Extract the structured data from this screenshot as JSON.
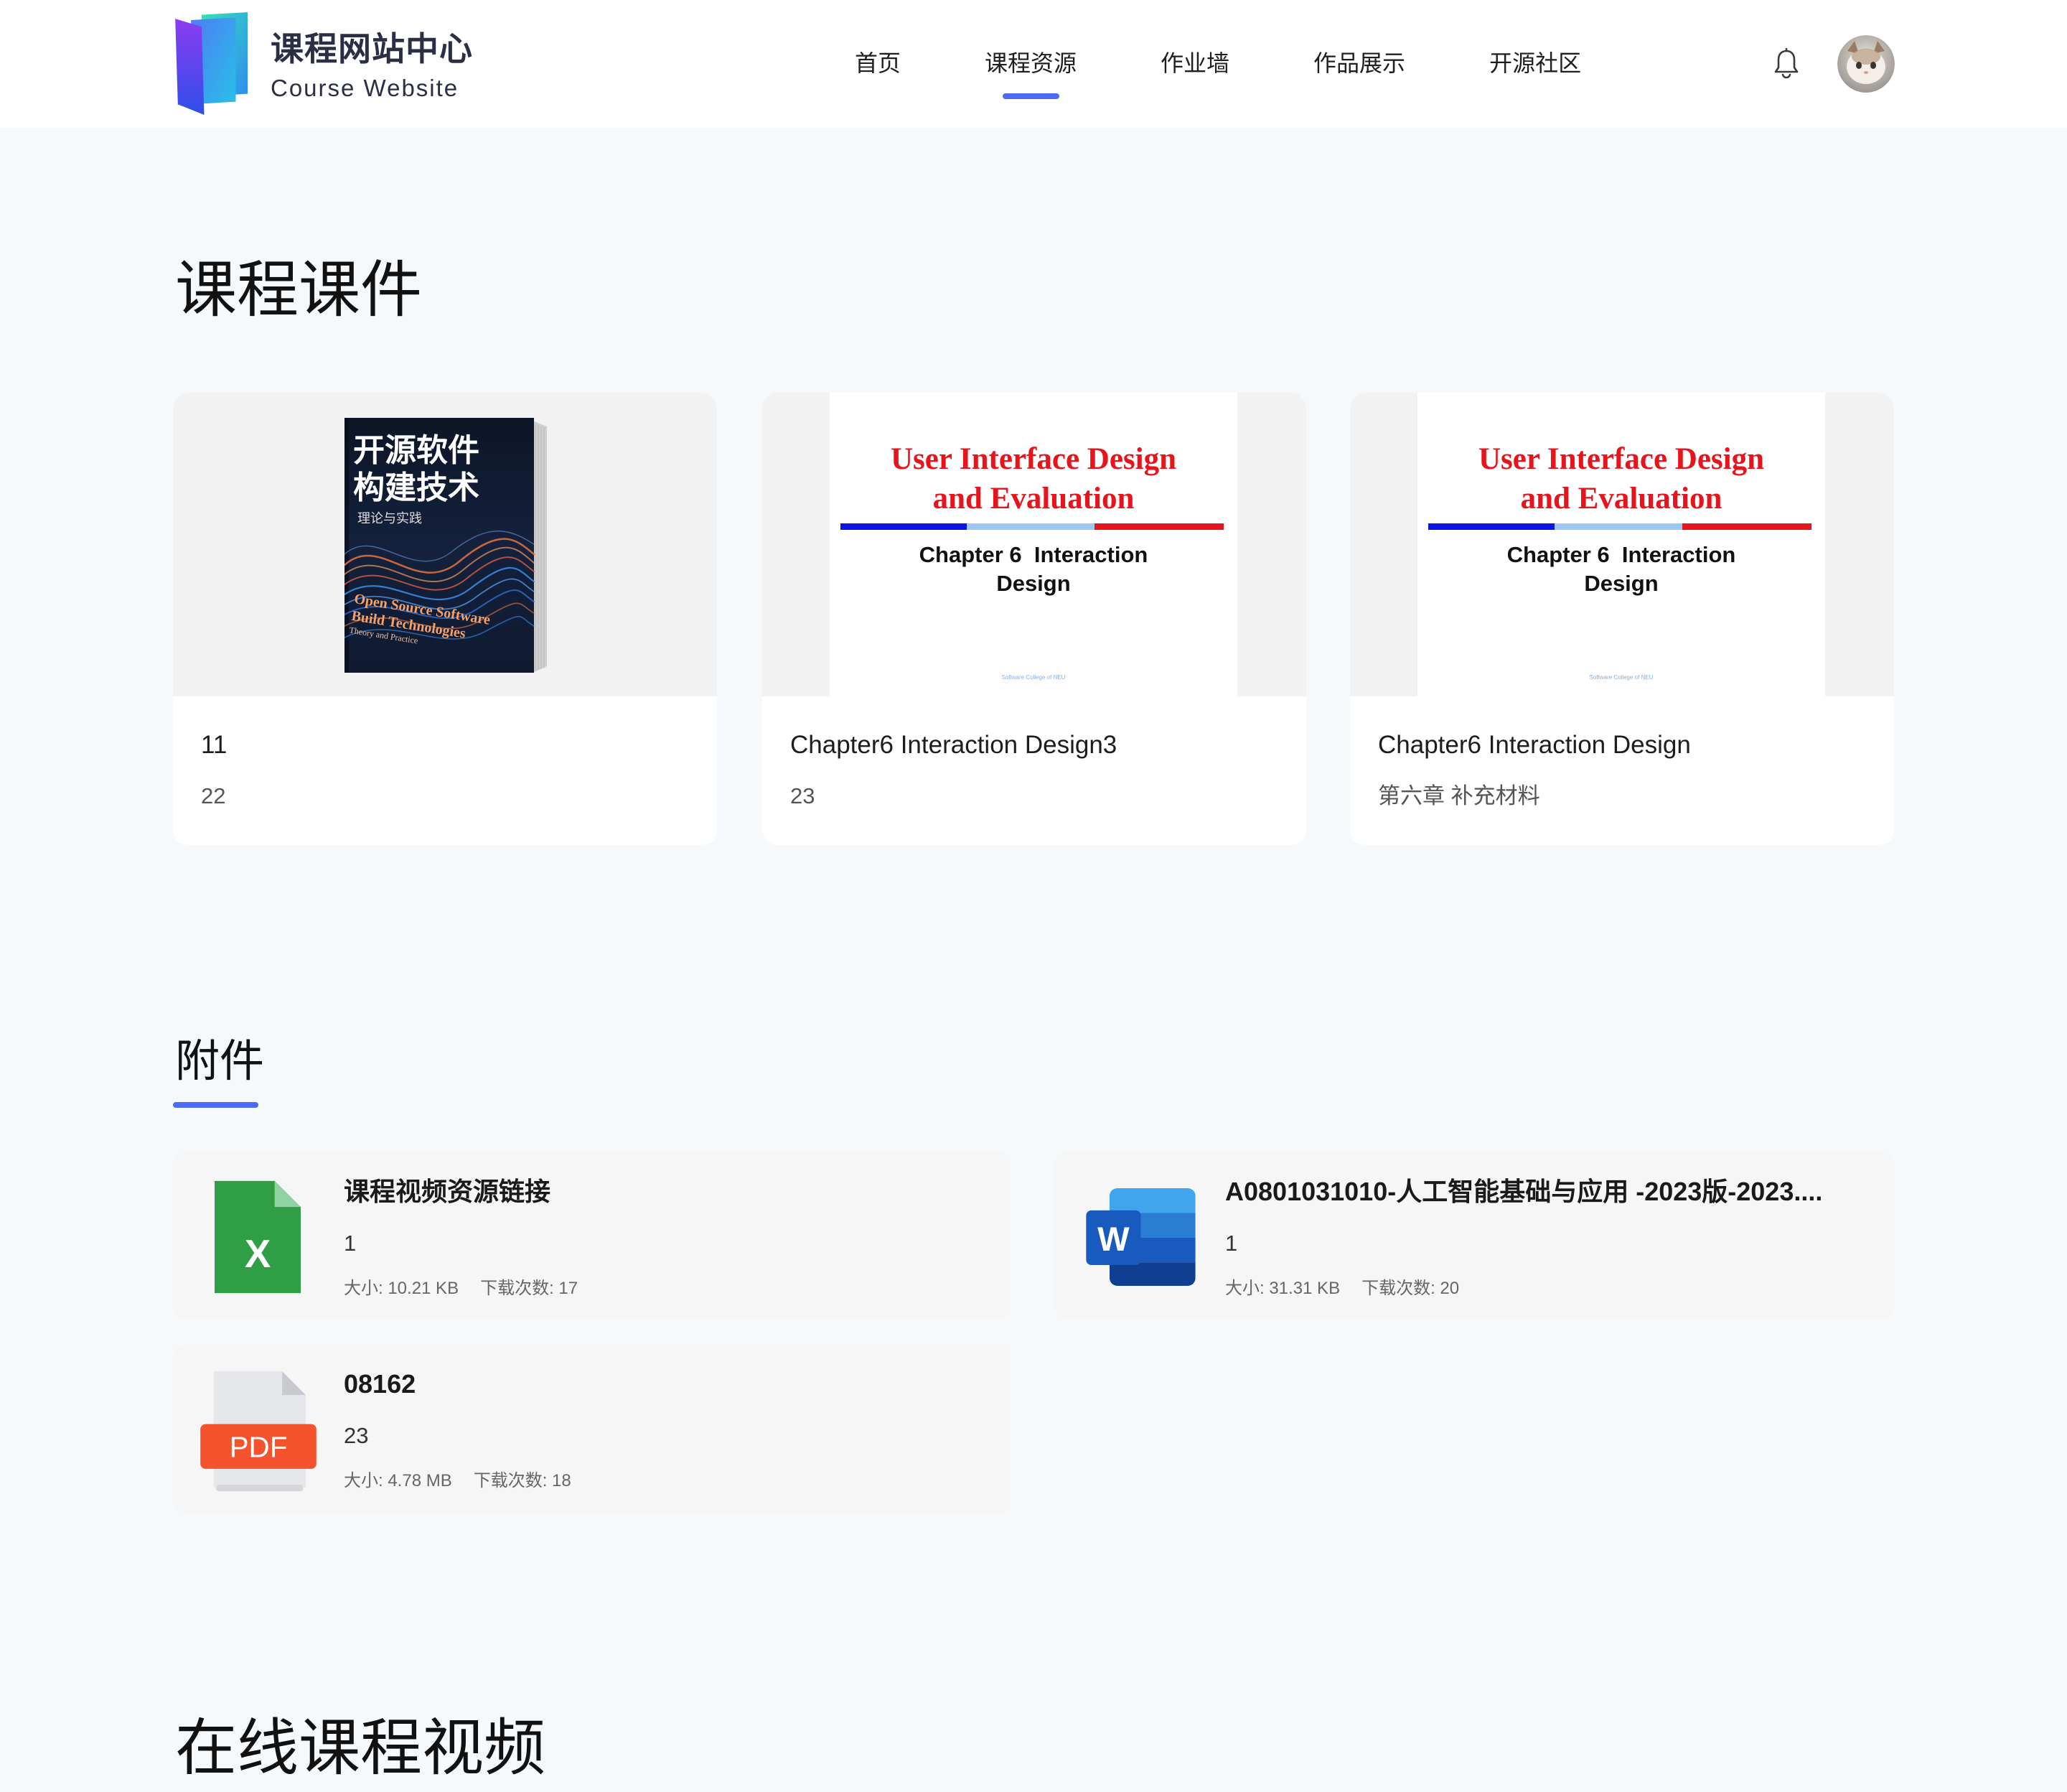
{
  "colors": {
    "accent": "#4a6cf7",
    "page_background": "#f6f9fb",
    "text_primary": "#1a1a1a",
    "text_secondary": "#555555",
    "slide_red": "#e8141b",
    "slide_blue": "#0a14e6",
    "slide_light_blue": "#9cc9f3",
    "excel_green": "#2f9e44",
    "word_blue": "#185abd",
    "pdf_red": "#f5532d"
  },
  "header": {
    "logo": {
      "icon": "book-logo-icon",
      "title": "课程网站中心",
      "subtitle": "Course Website"
    },
    "nav": [
      {
        "label": "首页",
        "active": false
      },
      {
        "label": "课程资源",
        "active": true
      },
      {
        "label": "作业墙",
        "active": false
      },
      {
        "label": "作品展示",
        "active": false
      },
      {
        "label": "开源社区",
        "active": false
      }
    ],
    "notification_icon": "bell-icon",
    "avatar_icon": "cat-avatar"
  },
  "courseware": {
    "title": "课程课件",
    "cards": [
      {
        "title": "11",
        "subtitle": "22",
        "cover": {
          "type": "book",
          "title_line1": "开源软件",
          "title_line2": "构建技术",
          "subtitle": "理论与实践",
          "en_line1": "Open Source Software",
          "en_line2": "Build Technologies",
          "en_line3": "Theory and Practice"
        }
      },
      {
        "title": "Chapter6 Interaction Design3",
        "subtitle": "23",
        "cover": {
          "type": "slide",
          "heading_line1": "User Interface Design",
          "heading_line2": "and Evaluation",
          "chapter_line1": "Chapter 6  Interaction",
          "chapter_line2": "Design",
          "footer": "Software College of NEU"
        }
      },
      {
        "title": "Chapter6 Interaction Design",
        "subtitle": "第六章 补充材料",
        "cover": {
          "type": "slide",
          "heading_line1": "User Interface Design",
          "heading_line2": "and Evaluation",
          "chapter_line1": "Chapter 6  Interaction",
          "chapter_line2": "Design",
          "footer": "Software College of NEU"
        }
      }
    ]
  },
  "attachments": {
    "title": "附件",
    "items": [
      {
        "icon": "excel-file-icon",
        "icon_label": "X",
        "name": "课程视频资源链接",
        "description": "1",
        "size_label": "大小: 10.21 KB",
        "downloads_label": "下载次数: 17"
      },
      {
        "icon": "word-file-icon",
        "icon_label": "W",
        "name": "A0801031010-人工智能基础与应用 -2023版-2023....",
        "description": "1",
        "size_label": "大小: 31.31 KB",
        "downloads_label": "下载次数: 20"
      },
      {
        "icon": "pdf-file-icon",
        "icon_label": "PDF",
        "name": "08162",
        "description": "23",
        "size_label": "大小: 4.78 MB",
        "downloads_label": "下载次数: 18"
      }
    ]
  },
  "videos": {
    "title": "在线课程视频"
  }
}
